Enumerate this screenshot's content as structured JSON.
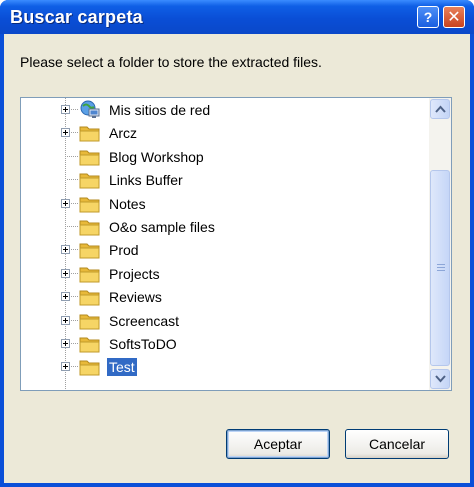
{
  "window": {
    "title": "Buscar carpeta",
    "help_label": "?",
    "close_label": "✕"
  },
  "instruction": "Please select a folder to store the extracted files.",
  "tree": {
    "items": [
      {
        "label": "Mis sitios de red",
        "icon": "network-icon",
        "expandable": true,
        "selected": false
      },
      {
        "label": "Arcz",
        "icon": "folder-icon",
        "expandable": true,
        "selected": false
      },
      {
        "label": "Blog Workshop",
        "icon": "folder-icon",
        "expandable": false,
        "selected": false
      },
      {
        "label": "Links Buffer",
        "icon": "folder-icon",
        "expandable": false,
        "selected": false
      },
      {
        "label": "Notes",
        "icon": "folder-icon",
        "expandable": true,
        "selected": false
      },
      {
        "label": "O&o sample files",
        "icon": "folder-icon",
        "expandable": false,
        "selected": false
      },
      {
        "label": "Prod",
        "icon": "folder-icon",
        "expandable": true,
        "selected": false
      },
      {
        "label": "Projects",
        "icon": "folder-icon",
        "expandable": true,
        "selected": false
      },
      {
        "label": "Reviews",
        "icon": "folder-icon",
        "expandable": true,
        "selected": false
      },
      {
        "label": "Screencast",
        "icon": "folder-icon",
        "expandable": true,
        "selected": false
      },
      {
        "label": "SoftsToDO",
        "icon": "folder-icon",
        "expandable": true,
        "selected": false
      },
      {
        "label": "Test",
        "icon": "folder-icon",
        "expandable": true,
        "selected": true
      }
    ]
  },
  "buttons": {
    "ok_label": "Aceptar",
    "cancel_label": "Cancelar"
  },
  "colors": {
    "title_bar": "#0a4ed6",
    "dialog_bg": "#ece9d8",
    "selection": "#316ac5",
    "folder": "#f6d565",
    "border": "#7f9db9"
  }
}
